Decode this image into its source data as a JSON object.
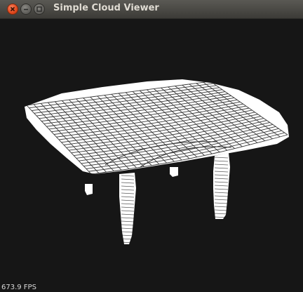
{
  "window": {
    "title": "Simple Cloud Viewer",
    "buttons": [
      "close-icon",
      "minimize-icon",
      "maximize-icon"
    ]
  },
  "viewport": {
    "background": "#161616",
    "cloud_color": "#ffffff",
    "object": "table",
    "fps_text": "673.9 FPS"
  }
}
